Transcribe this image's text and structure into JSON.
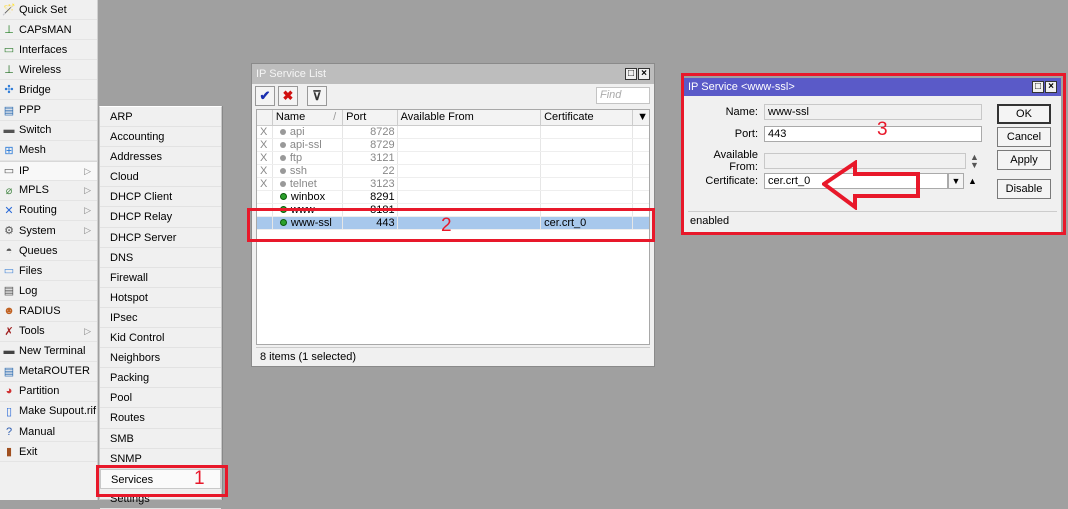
{
  "main_menu": {
    "items": [
      {
        "label": "Quick Set",
        "icon": "quick-set-icon",
        "glyph": "🪄",
        "submenu": false
      },
      {
        "label": "CAPsMAN",
        "icon": "antenna-icon",
        "glyph": "⊥",
        "submenu": false
      },
      {
        "label": "Interfaces",
        "icon": "interfaces-icon",
        "glyph": "▭",
        "submenu": false
      },
      {
        "label": "Wireless",
        "icon": "wireless-icon",
        "glyph": "⊥",
        "submenu": false
      },
      {
        "label": "Bridge",
        "icon": "bridge-icon",
        "glyph": "✣",
        "submenu": false
      },
      {
        "label": "PPP",
        "icon": "ppp-icon",
        "glyph": "▤",
        "submenu": false
      },
      {
        "label": "Switch",
        "icon": "switch-icon",
        "glyph": "▬",
        "submenu": false
      },
      {
        "label": "Mesh",
        "icon": "mesh-icon",
        "glyph": "⊞",
        "submenu": false
      },
      {
        "label": "IP",
        "icon": "ip-icon",
        "glyph": "▭",
        "submenu": true
      },
      {
        "label": "MPLS",
        "icon": "mpls-icon",
        "glyph": "⌀",
        "submenu": true
      },
      {
        "label": "Routing",
        "icon": "routing-icon",
        "glyph": "✕",
        "submenu": true
      },
      {
        "label": "System",
        "icon": "gear-icon",
        "glyph": "⚙",
        "submenu": true
      },
      {
        "label": "Queues",
        "icon": "queues-icon",
        "glyph": "◓",
        "submenu": false
      },
      {
        "label": "Files",
        "icon": "folder-icon",
        "glyph": "▭",
        "submenu": false
      },
      {
        "label": "Log",
        "icon": "log-icon",
        "glyph": "▤",
        "submenu": false
      },
      {
        "label": "RADIUS",
        "icon": "radius-icon",
        "glyph": "☻",
        "submenu": false
      },
      {
        "label": "Tools",
        "icon": "tools-icon",
        "glyph": "✗",
        "submenu": true
      },
      {
        "label": "New Terminal",
        "icon": "terminal-icon",
        "glyph": "▬",
        "submenu": false
      },
      {
        "label": "MetaROUTER",
        "icon": "metarouter-icon",
        "glyph": "▤",
        "submenu": false
      },
      {
        "label": "Partition",
        "icon": "partition-icon",
        "glyph": "◕",
        "submenu": false
      },
      {
        "label": "Make Supout.rif",
        "icon": "supout-icon",
        "glyph": "▯",
        "submenu": false
      },
      {
        "label": "Manual",
        "icon": "help-icon",
        "glyph": "?",
        "submenu": false
      },
      {
        "label": "Exit",
        "icon": "exit-icon",
        "glyph": "▮",
        "submenu": false
      }
    ],
    "submenu_arrow": "▷"
  },
  "ip_submenu": {
    "items": [
      "ARP",
      "Accounting",
      "Addresses",
      "Cloud",
      "DHCP Client",
      "DHCP Relay",
      "DHCP Server",
      "DNS",
      "Firewall",
      "Hotspot",
      "IPsec",
      "Kid Control",
      "Neighbors",
      "Packing",
      "Pool",
      "Routes",
      "SMB",
      "SNMP",
      "Services",
      "Settings"
    ],
    "selected": "Services"
  },
  "annotations": {
    "step1": "1",
    "step2": "2",
    "step3": "3",
    "color": "#e8182a"
  },
  "service_list": {
    "title": "IP Service List",
    "toolbar": {
      "enable": "✔",
      "disable": "✖",
      "filter": "⊽",
      "find_placeholder": "Find"
    },
    "columns": [
      "",
      "Name",
      "Port",
      "Available From",
      "Certificate"
    ],
    "sort_indicator": "/",
    "rows": [
      {
        "flag": "X",
        "name": "api",
        "port": "8728",
        "available_from": "",
        "certificate": "",
        "state": "disabled"
      },
      {
        "flag": "X",
        "name": "api-ssl",
        "port": "8729",
        "available_from": "",
        "certificate": "",
        "state": "disabled"
      },
      {
        "flag": "X",
        "name": "ftp",
        "port": "3121",
        "available_from": "",
        "certificate": "",
        "state": "disabled"
      },
      {
        "flag": "X",
        "name": "ssh",
        "port": "22",
        "available_from": "",
        "certificate": "",
        "state": "disabled"
      },
      {
        "flag": "X",
        "name": "telnet",
        "port": "3123",
        "available_from": "",
        "certificate": "",
        "state": "disabled"
      },
      {
        "flag": "",
        "name": "winbox",
        "port": "8291",
        "available_from": "",
        "certificate": "",
        "state": "enabled"
      },
      {
        "flag": "",
        "name": "www",
        "port": "8181",
        "available_from": "",
        "certificate": "",
        "state": "enabled"
      },
      {
        "flag": "",
        "name": "www-ssl",
        "port": "443",
        "available_from": "",
        "certificate": "cer.crt_0",
        "state": "selected"
      }
    ],
    "status": "8 items (1 selected)"
  },
  "service_dialog": {
    "title": "IP Service <www-ssl>",
    "fields": {
      "name_label": "Name:",
      "name_value": "www-ssl",
      "port_label": "Port:",
      "port_value": "443",
      "avail_label": "Available From:",
      "avail_value": "",
      "cert_label": "Certificate:",
      "cert_value": "cer.crt_0"
    },
    "buttons": {
      "ok": "OK",
      "cancel": "Cancel",
      "apply": "Apply",
      "disable": "Disable"
    },
    "status": "enabled"
  },
  "window_controls": {
    "maximize": "□",
    "close": "×"
  }
}
